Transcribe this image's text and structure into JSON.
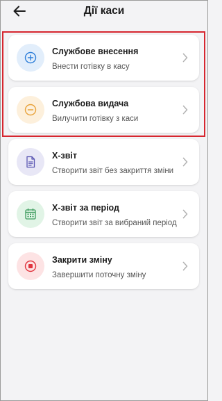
{
  "header": {
    "title": "Дії каси",
    "back_icon": "arrow-left-icon"
  },
  "actions": [
    {
      "title": "Службове внесення",
      "subtitle": "Внести готівку в касу",
      "icon": "plus-circle-icon",
      "icon_color": "#2f7fd9",
      "icon_bg": "#e2eefb"
    },
    {
      "title": "Службова видача",
      "subtitle": "Вилучити готівку з каси",
      "icon": "minus-circle-icon",
      "icon_color": "#e8a23a",
      "icon_bg": "#fdf0dc"
    },
    {
      "title": "Х-звіт",
      "subtitle": "Створити звіт без закриття зміни",
      "icon": "document-icon",
      "icon_color": "#5b57b3",
      "icon_bg": "#e8e7f6"
    },
    {
      "title": "Х-звіт за період",
      "subtitle": "Створити звіт за вибраний період",
      "icon": "calendar-icon",
      "icon_color": "#3a9a5b",
      "icon_bg": "#e1f4e6"
    },
    {
      "title": "Закрити зміну",
      "subtitle": "Завершити поточну зміну",
      "icon": "stop-circle-icon",
      "icon_color": "#e0343e",
      "icon_bg": "#fde3e4"
    }
  ],
  "colors": {
    "highlight_border": "#d6262f",
    "background": "#f3f3f5",
    "chevron": "#b3b3b3"
  }
}
